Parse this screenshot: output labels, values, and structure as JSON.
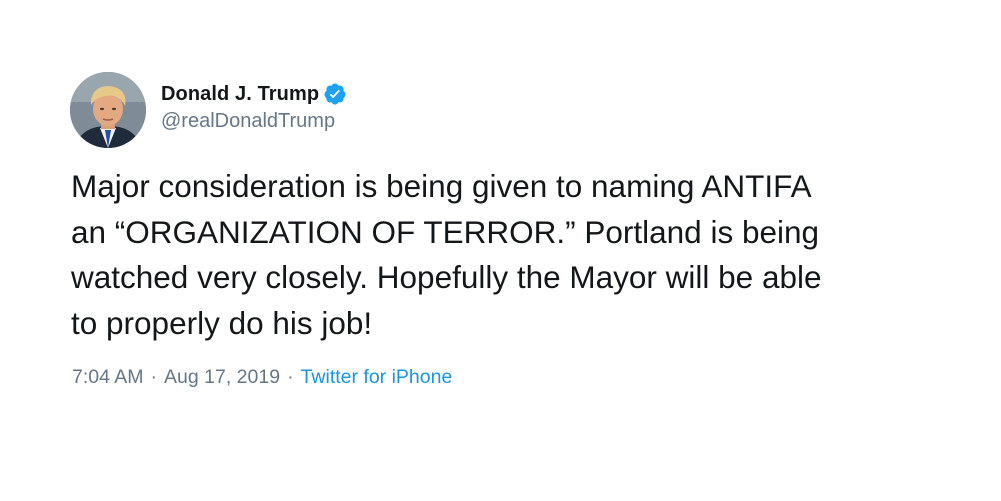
{
  "author": {
    "display_name": "Donald J. Trump",
    "handle": "@realDonaldTrump",
    "verified": true,
    "verified_icon": "verified-badge-icon",
    "verified_color": "#1da1f2"
  },
  "tweet": {
    "text": "Major consideration is being given to naming ANTIFA\nan “ORGANIZATION OF TERROR.” Portland is being\nwatched very closely. Hopefully the Mayor will be able\nto properly do his job!"
  },
  "meta": {
    "time": "7:04 AM",
    "separator": "·",
    "date": "Aug 17, 2019",
    "source": "Twitter for iPhone"
  },
  "colors": {
    "text_primary": "#14171a",
    "text_secondary": "#657786",
    "link": "#1b95e0"
  }
}
